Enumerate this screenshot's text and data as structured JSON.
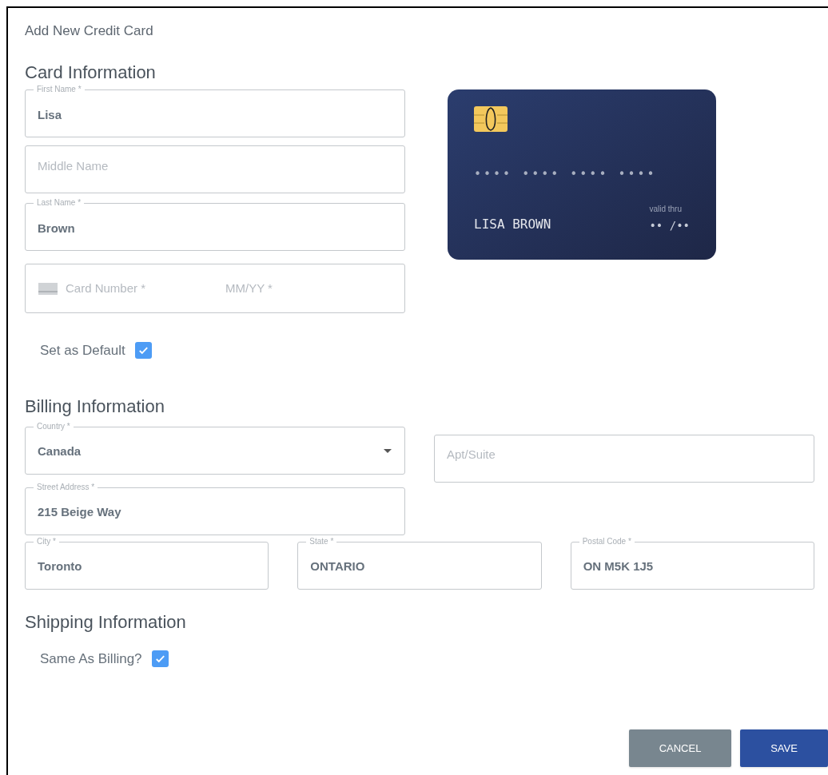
{
  "dialog": {
    "title": "Add New Credit Card"
  },
  "card_section": {
    "heading": "Card Information",
    "fields": [
      {
        "kind": "text",
        "label": "First Name *",
        "value": "Lisa"
      },
      {
        "kind": "text",
        "placeholder": "Middle Name"
      },
      {
        "kind": "text",
        "label": "Last Name *",
        "value": "Brown"
      },
      {
        "kind": "card",
        "placeholder": "Card Number *",
        "expiry_placeholder": "MM/YY *"
      }
    ],
    "default_checkbox": {
      "label": "Set as Default",
      "checked": true
    }
  },
  "card_preview": {
    "number": "•••• •••• •••• ••••",
    "holder": "LISA BROWN",
    "valid_label": "valid thru",
    "expiry": "•• /••"
  },
  "billing_section": {
    "heading": "Billing Information",
    "fields": [
      {
        "kind": "select",
        "label": "Country *",
        "value": "Canada"
      },
      {
        "kind": "text",
        "placeholder": "Apt/Suite"
      },
      {
        "kind": "text",
        "label": "Street Address *",
        "value": "215 Beige Way"
      },
      {
        "kind": "text",
        "label": "City *",
        "value": "Toronto"
      },
      {
        "kind": "text",
        "label": "State *",
        "value": "ONTARIO"
      },
      {
        "kind": "text",
        "label": "Postal Code *",
        "value": "ON M5K 1J5"
      }
    ]
  },
  "shipping_section": {
    "heading": "Shipping Information",
    "same_checkbox": {
      "label": "Same As Billing?",
      "checked": true
    }
  },
  "buttons": [
    {
      "kind": "secondary",
      "label": "CANCEL"
    },
    {
      "kind": "primary",
      "label": "SAVE"
    }
  ]
}
